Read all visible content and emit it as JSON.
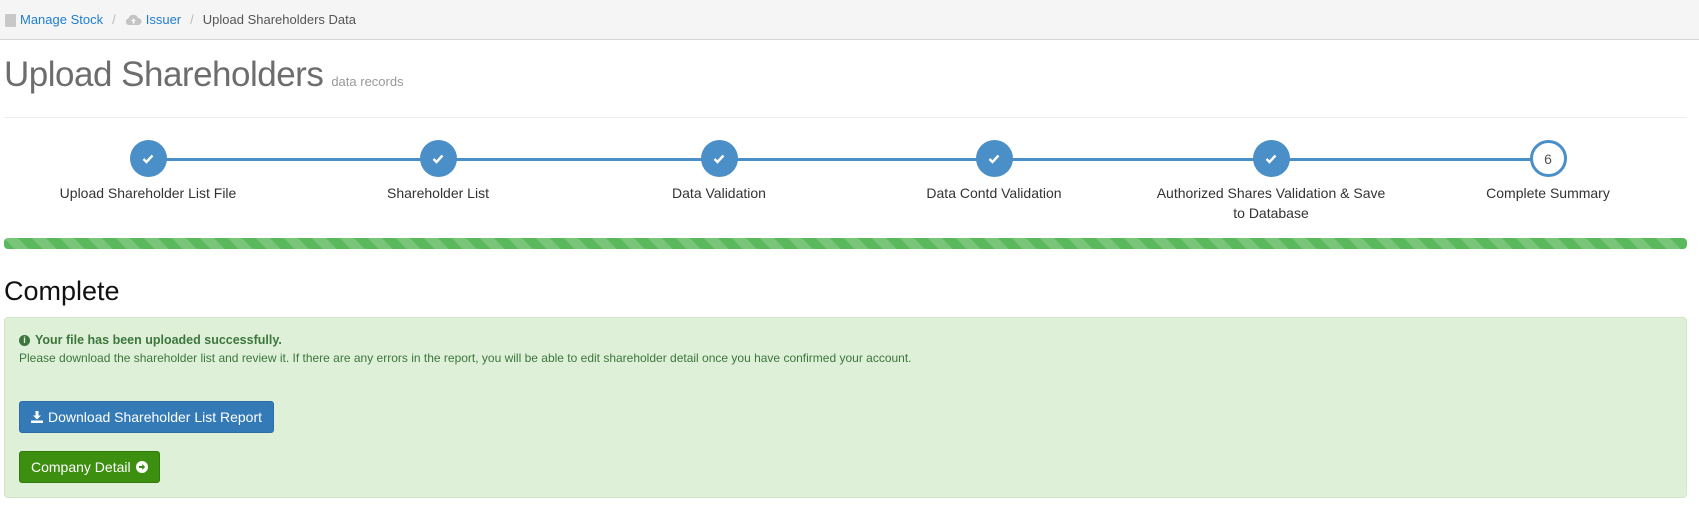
{
  "breadcrumb": {
    "items": [
      {
        "label": "Manage Stock",
        "icon": "document-icon"
      },
      {
        "label": "Issuer",
        "icon": "cloud-upload-icon"
      },
      {
        "label": "Upload Shareholders Data"
      }
    ],
    "separator": "/"
  },
  "header": {
    "title": "Upload Shareholders",
    "subtitle": "data records"
  },
  "wizard": {
    "steps": [
      {
        "label": "Upload Shareholder List File",
        "status": "done",
        "icon": "check-icon"
      },
      {
        "label": "Shareholder List",
        "status": "done",
        "icon": "check-icon"
      },
      {
        "label": "Data Validation",
        "status": "done",
        "icon": "check-icon"
      },
      {
        "label": "Data Contd Validation",
        "status": "done",
        "icon": "check-icon"
      },
      {
        "label": "Authorized Shares Validation & Save to Database",
        "status": "done",
        "icon": "check-icon"
      },
      {
        "label": "Complete Summary",
        "status": "current",
        "number": "6"
      }
    ],
    "progress": 1.0
  },
  "complete": {
    "title": "Complete",
    "alert_heading": "Your file has been uploaded successfully.",
    "alert_text": "Please download the shareholder list and review it. If there are any errors in the report, you will be able to edit shareholder detail once you have confirmed your account.",
    "download_button": "Download Shareholder List Report",
    "company_button": "Company Detail"
  },
  "colors": {
    "accent": "#4a8fc7",
    "success_bg": "#dff0d8",
    "success_text": "#3c763d",
    "primary_button": "#337ab7",
    "success_button": "#3d8f10",
    "progress": "#5cb85c"
  }
}
